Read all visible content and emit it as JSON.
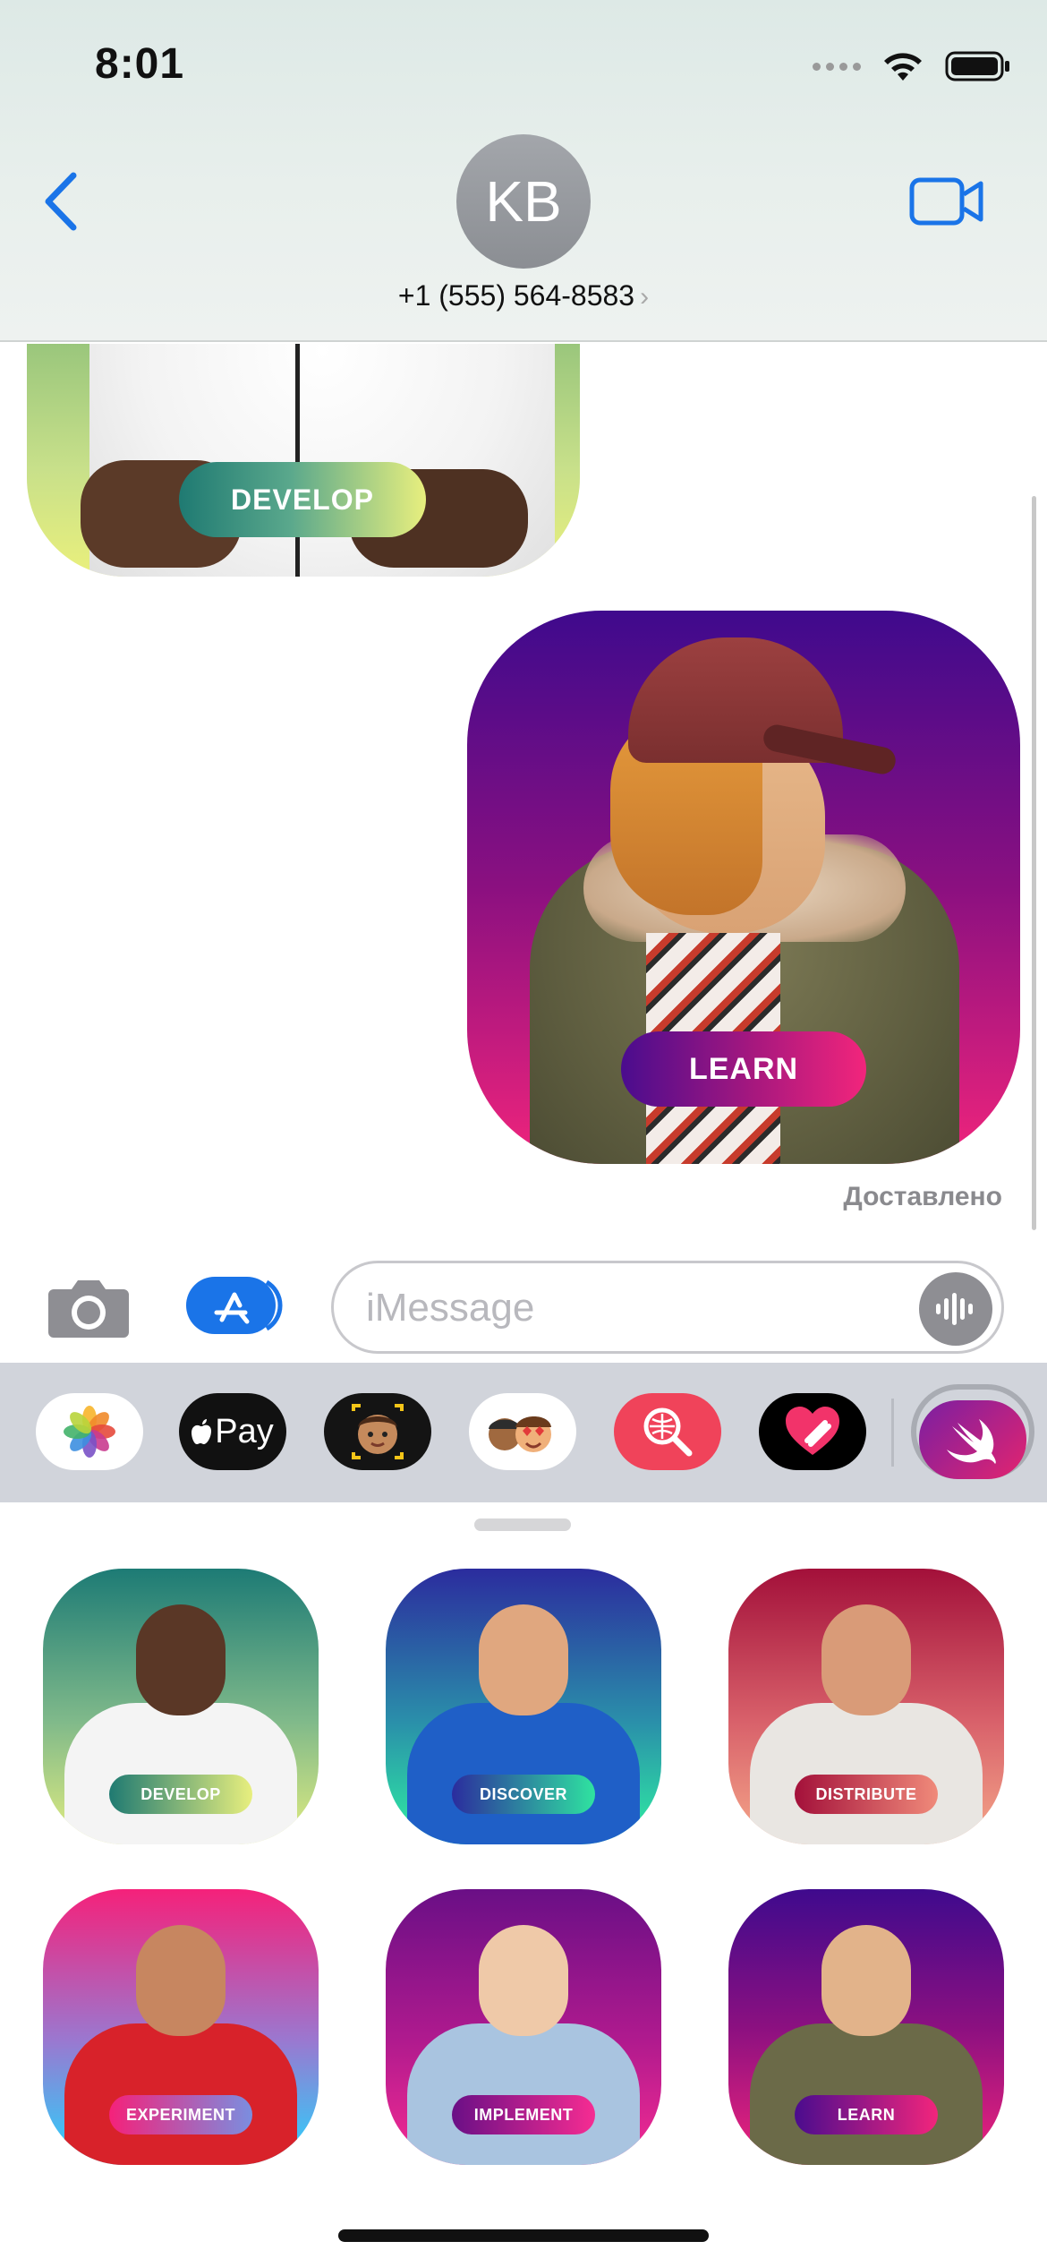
{
  "status_bar": {
    "time": "8:01"
  },
  "header": {
    "avatar_initials": "KB",
    "contact_number": "+1 (555) 564-8583",
    "chevron": "›"
  },
  "messages": [
    {
      "type": "sticker",
      "label": "DEVELOP",
      "side": "left",
      "partially_visible": true
    },
    {
      "type": "sticker",
      "label": "LEARN",
      "side": "right"
    }
  ],
  "delivery_status": "Доставлено",
  "compose": {
    "placeholder": "iMessage"
  },
  "app_strip": {
    "items": [
      {
        "name": "photos-app-icon"
      },
      {
        "name": "apple-pay-app-icon",
        "label": "Pay"
      },
      {
        "name": "memoji-app-icon"
      },
      {
        "name": "memoji-stickers-app-icon"
      },
      {
        "name": "image-search-app-icon"
      },
      {
        "name": "digital-touch-app-icon"
      },
      {
        "name": "swift-stickers-app-icon",
        "selected": true
      }
    ]
  },
  "sticker_grid": [
    {
      "label": "DEVELOP",
      "colors": [
        "#1d7b75",
        "#e3ed80"
      ]
    },
    {
      "label": "DISCOVER",
      "colors": [
        "#2b2c9e",
        "#2ff0a2"
      ]
    },
    {
      "label": "DISTRIBUTE",
      "colors": [
        "#a3103a",
        "#f5a88a"
      ]
    },
    {
      "label": "EXPERIMENT",
      "colors": [
        "#f5217a",
        "#25d6ff"
      ]
    },
    {
      "label": "IMPLEMENT",
      "colors": [
        "#6a0f86",
        "#f62c92"
      ]
    },
    {
      "label": "LEARN",
      "colors": [
        "#3f0a8d",
        "#f0247c"
      ]
    }
  ],
  "colors": {
    "ios_blue": "#1a74e8",
    "delivered_gray": "#8a8a8e"
  }
}
